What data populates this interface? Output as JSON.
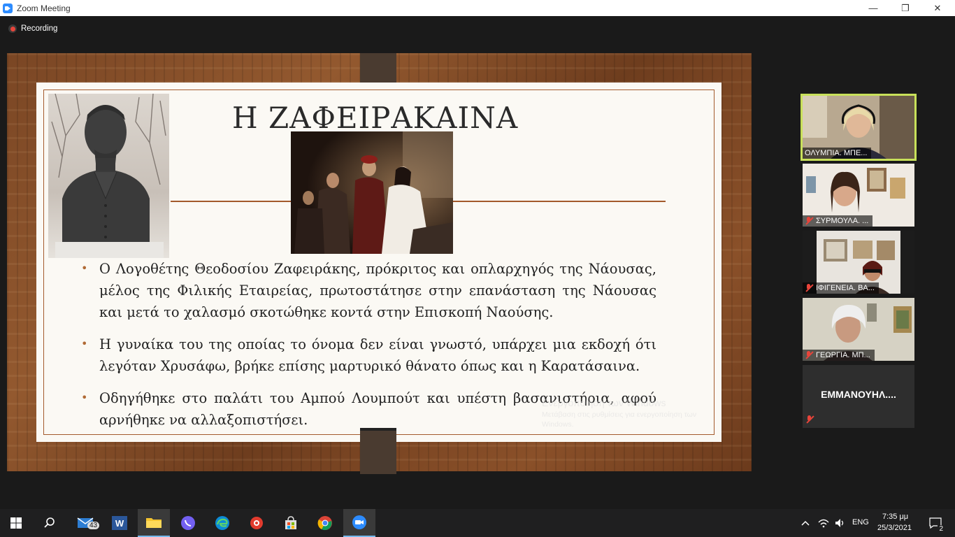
{
  "window": {
    "title": "Zoom Meeting"
  },
  "window_controls": {
    "minimize": "—",
    "restore": "❐",
    "close": "✕"
  },
  "recording": {
    "label": "Recording"
  },
  "slide": {
    "title": "Η ΖΑΦΕΙΡΑΚΑΙΝΑ",
    "bullets": [
      "Ο Λογοθέτης Θεοδοσίου Ζαφειράκης, πρόκριτος και οπλαρχηγός της Νάουσας, μέλος της Φιλικής Εταιρείας, πρωτοστάτησε στην επανάσταση της Νάουσας και μετά το χαλασμό σκοτώθηκε κοντά στην Επισκοπή Ναούσης.",
      "Η γυναίκα του της οποίας το όνομα δεν είναι γνωστό, υπάρχει μια εκδοχή ότι λεγόταν Χρυσάφω, βρήκε επίσης μαρτυρικό θάνατο όπως και η Καρατάσαινα.",
      "Οδηγήθηκε στο παλάτι του Αμπού Λουμπούτ και υπέστη βασανιστήρια, αφού αρνήθηκε να αλλαξοπιστήσει."
    ],
    "bullet_symbol": "•"
  },
  "watermark": {
    "line1": "Ενεργοποίηση των Windows",
    "line2": "Μετάβαση στις ρυθμίσεις για ενεργοποίηση των Windows."
  },
  "participants": [
    {
      "name": "ΟΛΥΜΠΙΑ. ΜΠΕ...",
      "muted": false,
      "active_speaker": true
    },
    {
      "name": "ΣΥΡΜΟΥΛΑ. ...",
      "muted": true
    },
    {
      "name": "ΙΦΙΓΕΝΕΙΑ. ΒΑ...",
      "muted": true
    },
    {
      "name": "ΓΕΩΡΓΙΑ. ΜΠ...",
      "muted": true
    },
    {
      "name": "ΕΜΜΑΝΟΥΗΛ....",
      "muted": true,
      "video_off": true
    }
  ],
  "taskbar": {
    "mail_badge": "43",
    "word_label": "W",
    "language": "ENG",
    "time": "7:35 μμ",
    "date": "25/3/2021",
    "notifications": "2"
  },
  "colors": {
    "accent_border": "#a35a2c",
    "active_speaker": "#c8e05a",
    "zoom_blue": "#2d8cff"
  }
}
